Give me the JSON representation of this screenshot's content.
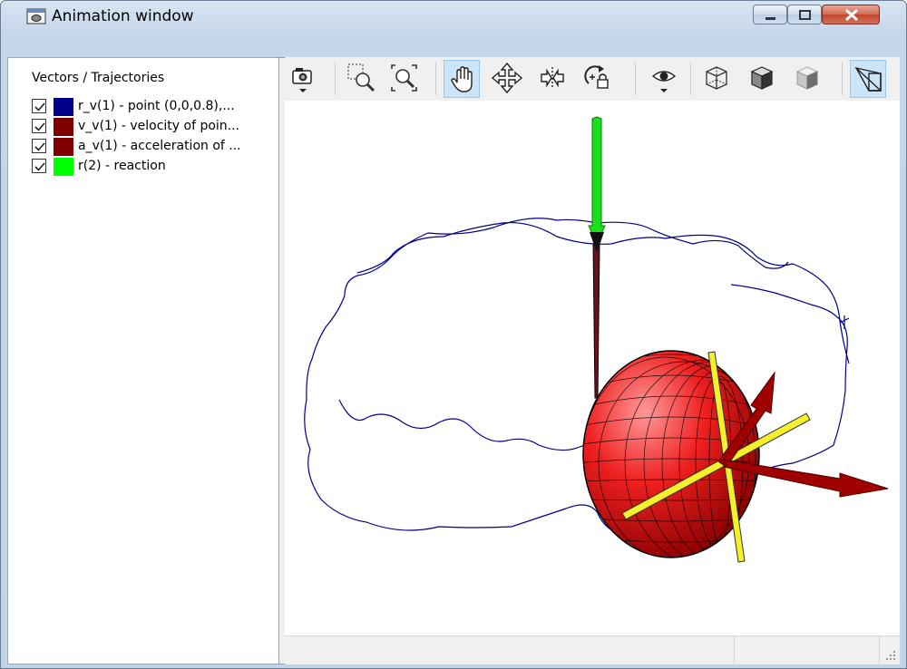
{
  "window": {
    "title": "Animation window",
    "icons": [
      "window-app-icon",
      "minimize-icon",
      "maximize-icon",
      "close-icon"
    ]
  },
  "panel": {
    "title": "Vectors / Trajectories",
    "items": [
      {
        "label": "r_v(1) - point (0,0,0.8),...",
        "color": "#00008b",
        "checked": true
      },
      {
        "label": "v_v(1) - velocity of poin...",
        "color": "#800000",
        "checked": true
      },
      {
        "label": "a_v(1) - acceleration of ...",
        "color": "#800000",
        "checked": true
      },
      {
        "label": "r(2) - reaction",
        "color": "#00ff00",
        "checked": true
      }
    ]
  },
  "toolbar": {
    "buttons": [
      {
        "name": "camera-dropdown-icon",
        "pressed": false
      },
      {
        "name": "zoom-region-icon",
        "pressed": false
      },
      {
        "name": "zoom-fit-icon",
        "pressed": false
      },
      {
        "name": "pan-hand-icon",
        "pressed": true
      },
      {
        "name": "move-view-icon",
        "pressed": false
      },
      {
        "name": "rotate-horizontal-icon",
        "pressed": false
      },
      {
        "name": "rotate-locked-icon",
        "pressed": false
      },
      {
        "name": "eye-view-dropdown-icon",
        "pressed": false
      },
      {
        "name": "wireframe-cube-icon",
        "pressed": false
      },
      {
        "name": "solid-cube-icon",
        "pressed": false
      },
      {
        "name": "shaded-cube-icon",
        "pressed": false
      },
      {
        "name": "perspective-projection-icon",
        "pressed": true
      }
    ]
  },
  "scene": {
    "trajectory_color": "#00008b",
    "body_color": "#e00000",
    "axis_color": "#ffff00",
    "reaction_color": "#00ff00",
    "vector_color": "#8b0000"
  }
}
